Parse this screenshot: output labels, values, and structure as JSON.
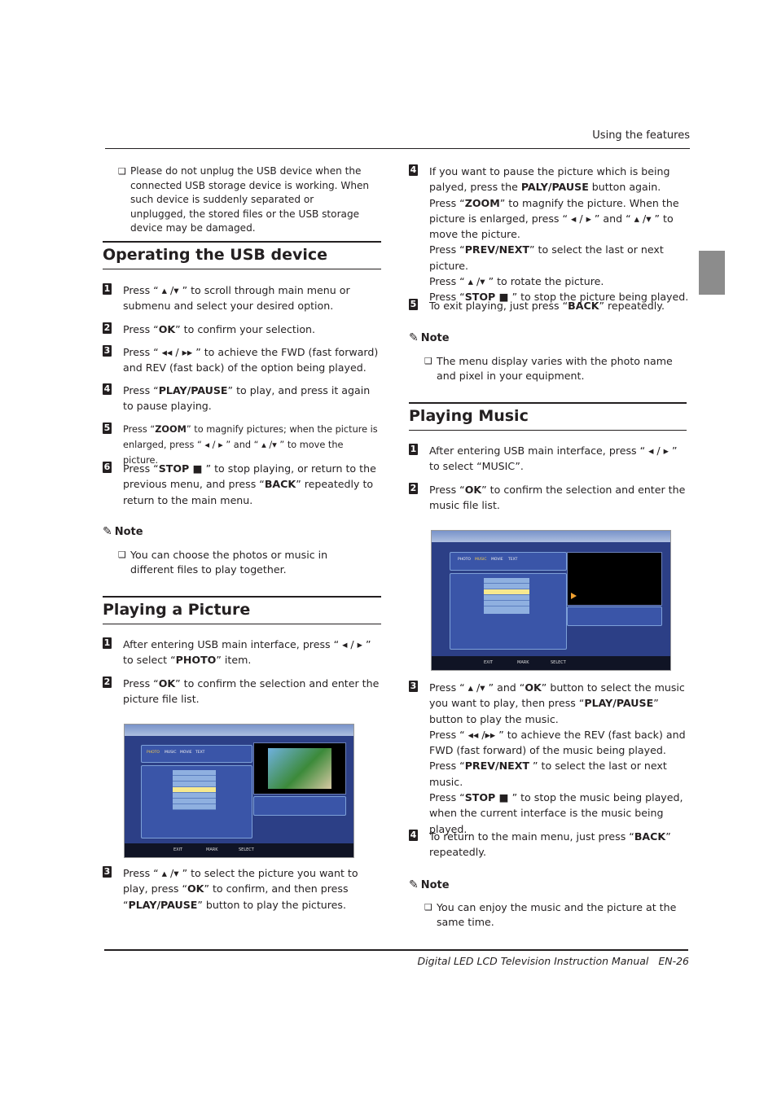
{
  "header": {
    "section": "Using the features"
  },
  "footer": {
    "title": "Digital LED LCD Television Instruction Manual",
    "page": "EN-26"
  },
  "left": {
    "warning": "Please do not unplug the USB device when the connected USB storage device is working. When such device is suddenly separated or unplugged, the stored files or the USB storage device may be damaged.",
    "section1": {
      "title": "Operating the USB device",
      "steps": [
        {
          "n": "1",
          "text": "Press “ ▴ /▾ ” to scroll through main menu or submenu and select your desired option."
        },
        {
          "n": "2",
          "text": "Press “**OK**” to confirm your selection."
        },
        {
          "n": "3",
          "text": "Press “ ◂◂ / ▸▸ ” to achieve the FWD (fast forward) and REV (fast back) of the option being played."
        },
        {
          "n": "4",
          "text": "Press “**PLAY/PAUSE**” to play, and press it again to pause playing."
        },
        {
          "n": "5",
          "text": "Press “**ZOOM**” to magnify pictures; when the picture is enlarged, press “ ◂ / ▸ ” and “ ▴ /▾ ” to move the picture."
        },
        {
          "n": "6",
          "text": "Press “**STOP ■** ” to stop playing, or return to the previous menu, and press “**BACK**” repeatedly to return to the main menu."
        }
      ],
      "note_label": "Note",
      "note": "You can choose the photos or music in different files to play together."
    },
    "section2": {
      "title": "Playing a Picture",
      "steps": [
        {
          "n": "1",
          "text": "After entering USB main interface, press “ ◂ / ▸ ” to select “**PHOTO**” item."
        },
        {
          "n": "2",
          "text": "Press “**OK**” to confirm the selection and enter the picture file list."
        },
        {
          "n": "3",
          "text": "Press “ ▴ /▾ ” to select the picture you want to play, press “**OK**” to confirm, and then press “**PLAY/PAUSE**” button to play the pictures."
        }
      ]
    }
  },
  "right": {
    "steps": [
      {
        "n": "4",
        "text": "If you want to pause the picture which is being palyed, press the **PALY/PAUSE** button again.<br>Press “**ZOOM**” to magnify the picture. When the picture is enlarged, press “ ◂ / ▸ ” and “ ▴ /▾ ” to move the picture.<br>Press “**PREV/NEXT**” to select the last or next picture.<br>Press “ ▴ /▾ ” to rotate the picture.<br>Press “**STOP ■** ” to stop the picture being played."
      },
      {
        "n": "5",
        "text": "To exit playing, just press “**BACK**” repeatedly."
      }
    ],
    "note_label": "Note",
    "note": "The menu display varies with the photo name and pixel in your equipment.",
    "section3": {
      "title": "Playing Music",
      "steps": [
        {
          "n": "1",
          "text": "After entering USB main interface, press “ ◂ / ▸ ” to select “MUSIC”."
        },
        {
          "n": "2",
          "text": "Press “**OK**” to confirm the selection and enter the music file list."
        },
        {
          "n": "3",
          "text": "Press “ ▴ /▾ ” and “**OK**” button to select the music you want to play, then press “**PLAY/PAUSE**” button to play the music.<br>Press “ ◂◂ /▸▸ ” to achieve the REV (fast back) and FWD (fast forward) of the music being played.<br>Press “**PREV/NEXT** ” to select the last or next music.<br>Press “**STOP ■** ” to stop the music being played, when the current interface is the music being played."
        },
        {
          "n": "4",
          "text": "To return to the main menu, just press “**BACK**” repeatedly."
        }
      ],
      "note_label": "Note",
      "note": "You can enjoy the music and the picture at the same time."
    }
  },
  "screens": {
    "categories": [
      "PHOTO",
      "MUSIC",
      "MOVIE",
      "TEXT"
    ],
    "buttons": [
      "EXIT",
      "MARK",
      "SELECT"
    ]
  }
}
